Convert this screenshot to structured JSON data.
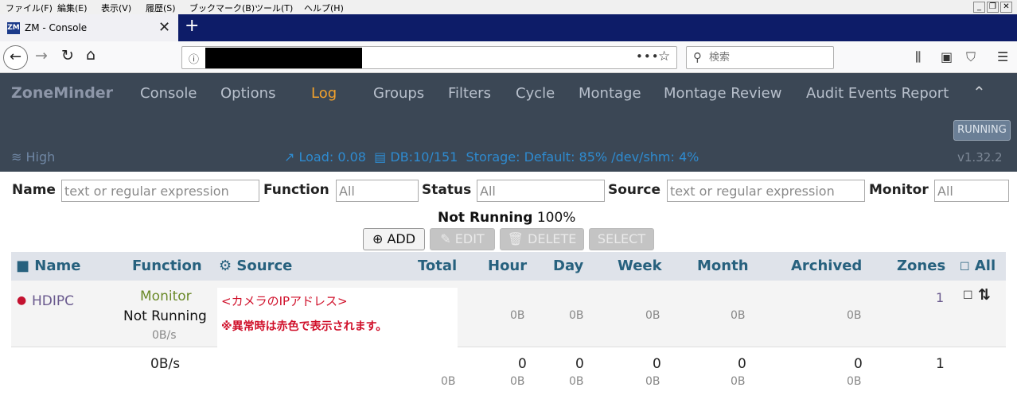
{
  "menubar": [
    "ファイル(F)",
    "編集(E)",
    "表示(V)",
    "履歴(S)",
    "ブックマーク(B)",
    "ツール(T)",
    "ヘルプ(H)"
  ],
  "tab": {
    "favicon": "ZM",
    "title": "ZM - Console",
    "close": "✕",
    "new": "+"
  },
  "searchbar": {
    "placeholder": "検索"
  },
  "zm": {
    "brand": "ZoneMinder",
    "nav": [
      "Console",
      "Options",
      "Log",
      "Groups",
      "Filters",
      "Cycle",
      "Montage",
      "Montage Review",
      "Audit Events Report"
    ],
    "active_nav": "Log",
    "state_button": "RUNNING",
    "bandwidth": "High",
    "load": "Load: 0.08",
    "db": "DB:10/151",
    "storage": "Storage: Default: 85% /dev/shm: 4%",
    "version": "v1.32.2"
  },
  "filters": {
    "name_label": "Name",
    "name_placeholder": "text or regular expression",
    "function_label": "Function",
    "function_value": "All",
    "status_label": "Status",
    "status_value": "All",
    "source_label": "Source",
    "source_placeholder": "text or regular expression",
    "monitor_label": "Monitor",
    "monitor_value": "All"
  },
  "summary": {
    "status": "Not Running",
    "percent": "100%"
  },
  "actions": {
    "add": "ADD",
    "edit": "EDIT",
    "delete": "DELETE",
    "select": "SELECT"
  },
  "columns": [
    "Name",
    "Function",
    "Source",
    "Total",
    "Hour",
    "Day",
    "Week",
    "Month",
    "Archived",
    "Zones",
    "All"
  ],
  "row": {
    "name": "HDIPC",
    "function": "Monitor",
    "status": "Not Running",
    "rate": "0B/s",
    "source_note_1": "<カメラのIPアドレス>",
    "source_note_2": "※異常時は赤色で表示されます。",
    "hour": "0B",
    "day": "0B",
    "week": "0B",
    "month": "0B",
    "archived": "0B",
    "zones": "1"
  },
  "footer": {
    "rate": "0B/s",
    "total": "0B",
    "hour": "0",
    "hour_size": "0B",
    "day": "0",
    "day_size": "0B",
    "week": "0",
    "week_size": "0B",
    "month": "0",
    "month_size": "0B",
    "archived": "0",
    "archived_size": "0B",
    "zones": "1"
  },
  "colors": {
    "header_bg": "#3b4755",
    "active": "#f2a12c",
    "link": "#27617e",
    "alert": "#d0102a"
  }
}
